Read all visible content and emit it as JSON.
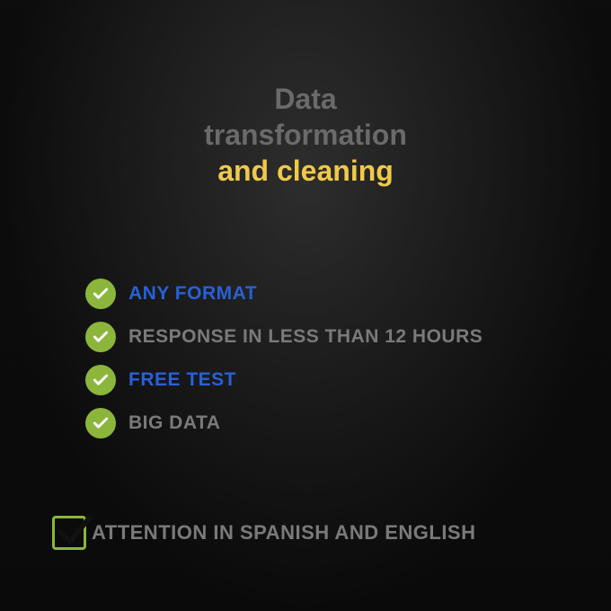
{
  "title": {
    "line1": "Data",
    "line2": "transformation",
    "line3": "and cleaning"
  },
  "features": [
    {
      "text": "ANY FORMAT",
      "color": "blue"
    },
    {
      "text": "RESPONSE IN LESS THAN 12 HOURS",
      "color": "gray"
    },
    {
      "text": "FREE TEST",
      "color": "blue"
    },
    {
      "text": "BIG DATA",
      "color": "gray"
    }
  ],
  "footer": {
    "text": "ATTENTION IN SPANISH AND ENGLISH"
  },
  "colors": {
    "accent_green": "#8bb63b",
    "accent_yellow": "#f0c94a",
    "accent_blue": "#2860d8",
    "muted_gray": "#7a7a7a"
  }
}
